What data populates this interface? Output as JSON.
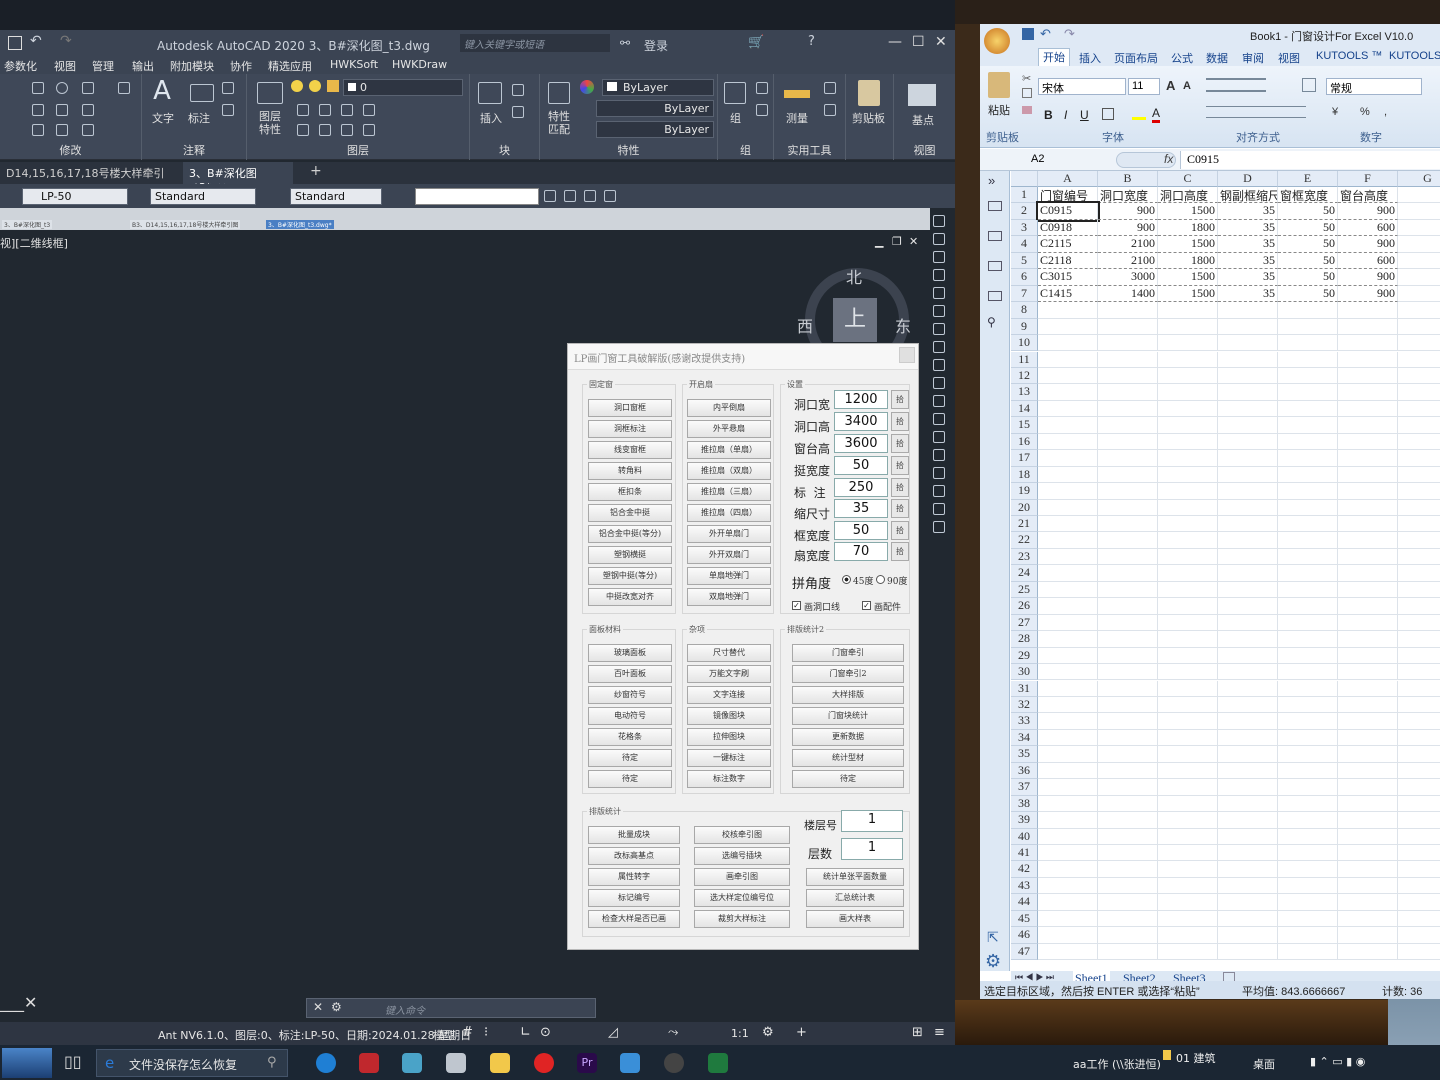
{
  "autocad": {
    "title": "Autodesk AutoCAD 2020  3、B#深化图_t3.dwg",
    "search_placeholder": "键入关键字或短语",
    "login": "登录",
    "menu": [
      "参数化",
      "视图",
      "管理",
      "输出",
      "附加模块",
      "协作",
      "精选应用",
      "HWKSoft",
      "HWKDraw"
    ],
    "panels": [
      "修改",
      "注释",
      "图层",
      "块",
      "特性",
      "组",
      "实用工具",
      "视图"
    ],
    "ribbon_texts": {
      "text": "文字",
      "dim": "标注",
      "layer_prop": "图层\n特性",
      "insert": "插入",
      "match": "特性\n匹配",
      "group": "组",
      "measure": "测量",
      "paste": "剪贴板",
      "base": "基点",
      "layer_val": "0",
      "bylayer1": "ByLayer",
      "bylayer2": "ByLayer",
      "bylayer3": "ByLayer"
    },
    "tabs": [
      "D14,15,16,17,18号楼大样牵引图*",
      "3、B#深化图_t3*"
    ],
    "props": {
      "layer": "LP-50",
      "style1": "Standard",
      "style2": "Standard"
    },
    "mini_tabs": [
      "3、B#深化图_t3",
      "B3、D14,15,16,17,18号楼大样牵引图",
      "3、B#深化图_t3.dwg*"
    ],
    "viewport_label": "视][二维线框]",
    "viewcube": {
      "n": "北",
      "w": "西",
      "e": "东",
      "top": "上"
    },
    "cmd_placeholder": "键入命令",
    "status_text": "Ant NV6.1.0、图层:0、标注:LP-50、日期:2024.01.28 星期日",
    "model": "模型",
    "scale": "1:1"
  },
  "lp": {
    "title": "LP画门窗工具破解版(感谢改提供支持)",
    "groups": {
      "fixed": "固定窗",
      "open": "开启扇",
      "settings": "设置",
      "panel": "面板材料",
      "misc": "杂项",
      "layout2": "排版统计2",
      "layout": "排版统计"
    },
    "fixed_buttons": [
      "洞口窗框",
      "洞框标注",
      "线变窗框",
      "转角料",
      "框扣条",
      "铝合金中挺",
      "铝合金中挺(等分)",
      "塑钢横挺",
      "塑钢中挺(等分)",
      "中挺改宽对齐"
    ],
    "open_buttons": [
      "内平倒扇",
      "外平悬扇",
      "推拉扇（单扇）",
      "推拉扇（双扇）",
      "推拉扇（三扇）",
      "推拉扇（四扇）",
      "外开单扇门",
      "外开双扇门",
      "单扇地弹门",
      "双扇地弹门"
    ],
    "settings": [
      {
        "label": "洞口宽",
        "value": "1200"
      },
      {
        "label": "洞口高",
        "value": "3400"
      },
      {
        "label": "窗台高",
        "value": "3600"
      },
      {
        "label": "挺宽度",
        "value": "50"
      },
      {
        "label": "标  注",
        "value": "250"
      },
      {
        "label": "缩尺寸",
        "value": "35"
      },
      {
        "label": "框宽度",
        "value": "50"
      },
      {
        "label": "扇宽度",
        "value": "70"
      }
    ],
    "pick": "拾",
    "angle_label": "拼角度",
    "angle_45": "45度",
    "angle_90": "90度",
    "chk_hole": "画洞口线",
    "chk_parts": "画配件",
    "panel_buttons": [
      "玻璃面板",
      "百叶面板",
      "纱窗符号",
      "电动符号",
      "花格条",
      "待定",
      "待定"
    ],
    "misc_buttons": [
      "尺寸替代",
      "万能文字刷",
      "文字连接",
      "镜像图块",
      "拉伸图块",
      "一键标注",
      "标注数字"
    ],
    "layout2_buttons": [
      "门窗牵引",
      "门窗牵引2",
      "大样排版",
      "门窗块统计",
      "更新数据",
      "统计型材",
      "待定"
    ],
    "layout_col1": [
      "批量成块",
      "改标高基点",
      "属性转字",
      "标记编号",
      "检查大样是否已画"
    ],
    "layout_col2": [
      "校核牵引图",
      "选编号插块",
      "画牵引图",
      "选大样定位编号位",
      "裁剪大样标注"
    ],
    "layout_col3": [
      "统计单张平面数量",
      "汇总统计表",
      "画大样表"
    ],
    "floor_label": "楼层号",
    "floor_value": "1",
    "count_label": "层数",
    "count_value": "1"
  },
  "excel": {
    "title": "Book1 - 门窗设计For Excel V10.0",
    "tabs": [
      "开始",
      "插入",
      "页面布局",
      "公式",
      "数据",
      "审阅",
      "视图",
      "KUTOOLS ™",
      "KUTOOLS"
    ],
    "font": "宋体",
    "font_size": "11",
    "number_format": "常规",
    "group_labels": [
      "剪贴板",
      "字体",
      "对齐方式",
      "数字"
    ],
    "paste": "粘贴",
    "name_box": "A2",
    "formula": "C0915",
    "fx": "fx",
    "columns": [
      "A",
      "B",
      "C",
      "D",
      "E",
      "F",
      "G"
    ],
    "headers": [
      "门窗编号",
      "洞口宽度",
      "洞口高度",
      "钢副框缩尺寸",
      "窗框宽度",
      "窗台高度"
    ],
    "rows": [
      [
        "C0915",
        "900",
        "1500",
        "35",
        "50",
        "900"
      ],
      [
        "C0918",
        "900",
        "1800",
        "35",
        "50",
        "600"
      ],
      [
        "C2115",
        "2100",
        "1500",
        "35",
        "50",
        "900"
      ],
      [
        "C2118",
        "2100",
        "1800",
        "35",
        "50",
        "600"
      ],
      [
        "C3015",
        "3000",
        "1500",
        "35",
        "50",
        "900"
      ],
      [
        "C1415",
        "1400",
        "1500",
        "35",
        "50",
        "900"
      ]
    ],
    "row_numbers": [
      "1",
      "2",
      "3",
      "4",
      "5",
      "6",
      "7",
      "8",
      "9",
      "10",
      "11",
      "12",
      "13",
      "14",
      "15",
      "16",
      "17",
      "18",
      "19",
      "20",
      "21",
      "22",
      "23",
      "24",
      "25",
      "26",
      "27",
      "28",
      "29",
      "30",
      "31",
      "32",
      "33",
      "34",
      "35",
      "36",
      "37",
      "38",
      "39",
      "40",
      "41",
      "42",
      "43",
      "44",
      "45",
      "46",
      "47"
    ],
    "sheets": [
      "Sheet1",
      "Sheet2",
      "Sheet3"
    ],
    "status_left": "选定目标区域，然后按 ENTER 或选择“粘贴”",
    "status_avg": "平均值: 843.6666667",
    "status_count": "计数: 36"
  },
  "taskbar": {
    "search_text": "文件没保存怎么恢复",
    "work": "aa工作 (\\\\张进恒)",
    "folder": "01 建筑",
    "desktop": "桌面"
  }
}
